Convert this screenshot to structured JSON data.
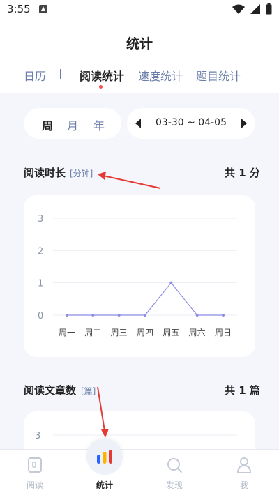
{
  "status": {
    "time": "3:55"
  },
  "header": {
    "title": "统计"
  },
  "tabs": [
    {
      "label": "日历"
    },
    {
      "label": "阅读统计"
    },
    {
      "label": "速度统计"
    },
    {
      "label": "题目统计"
    }
  ],
  "period": {
    "options": [
      "周",
      "月",
      "年"
    ],
    "selected": "周"
  },
  "range": {
    "text": "03-30 ~ 04-05"
  },
  "reading_time": {
    "title": "阅读时长",
    "unit": "[分钟]",
    "total": "共 1 分"
  },
  "reading_articles": {
    "title": "阅读文章数",
    "unit": "[篇]",
    "total": "共 1 篇"
  },
  "chart_data": [
    {
      "type": "line",
      "categories": [
        "周一",
        "周二",
        "周三",
        "周四",
        "周五",
        "周六",
        "周日"
      ],
      "values": [
        0,
        0,
        0,
        0,
        1,
        0,
        0
      ],
      "yticks": [
        0,
        1,
        2,
        3
      ],
      "ylim": [
        0,
        3
      ],
      "grid": true,
      "color": "#8c8ce6"
    },
    {
      "type": "line",
      "yticks": [
        3
      ],
      "ylim": [
        0,
        3
      ]
    }
  ],
  "nav": [
    {
      "label": "阅读",
      "icon": "book-icon"
    },
    {
      "label": "统计",
      "icon": "bar-chart-icon"
    },
    {
      "label": "发现",
      "icon": "search-icon"
    },
    {
      "label": "我",
      "icon": "user-icon"
    }
  ],
  "colors": {
    "accent": "#6b7ea8",
    "dot": "#ef5350",
    "annotation": "#e53935",
    "line": "#8c8ce6"
  }
}
